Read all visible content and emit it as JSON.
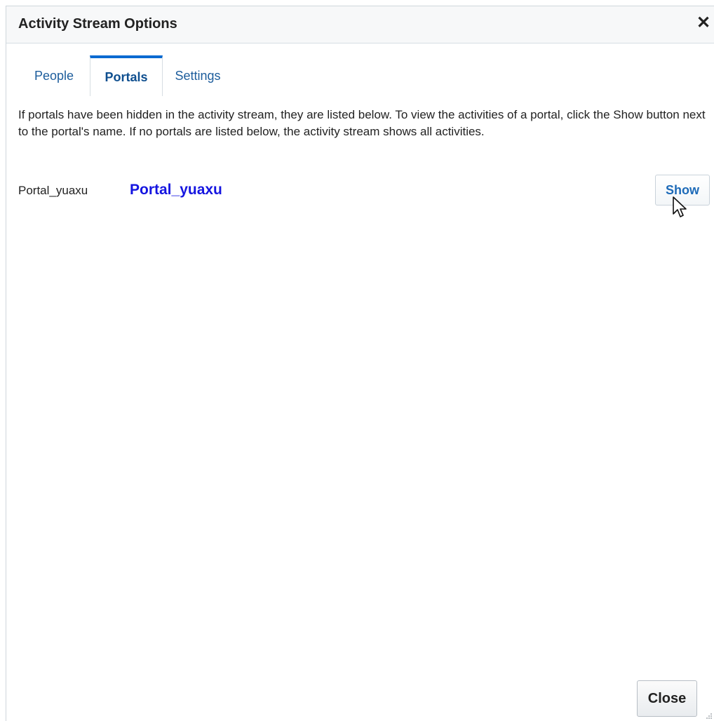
{
  "dialog": {
    "title": "Activity Stream Options",
    "close_icon_glyph": "✕"
  },
  "tabs": [
    {
      "label": "People",
      "selected": false
    },
    {
      "label": "Portals",
      "selected": true
    },
    {
      "label": "Settings",
      "selected": false
    }
  ],
  "content": {
    "description": "If portals have been hidden in the activity stream, they are listed below. To view the activities of a portal, click the Show button next to the portal's name. If no portals are listed below, the activity stream shows all activities.",
    "portals": [
      {
        "name": "Portal_yuaxu",
        "link_label": "Portal_yuaxu",
        "action_label": "Show"
      }
    ]
  },
  "footer": {
    "close_label": "Close"
  },
  "icons": {
    "close": "close-icon",
    "cursor": "mouse-pointer-icon",
    "resize": "resize-grip-icon"
  },
  "colors": {
    "accent": "#0a6ad1",
    "link": "#1515e0",
    "tab_text": "#1d5d9c",
    "show_text": "#1d6ab8"
  }
}
